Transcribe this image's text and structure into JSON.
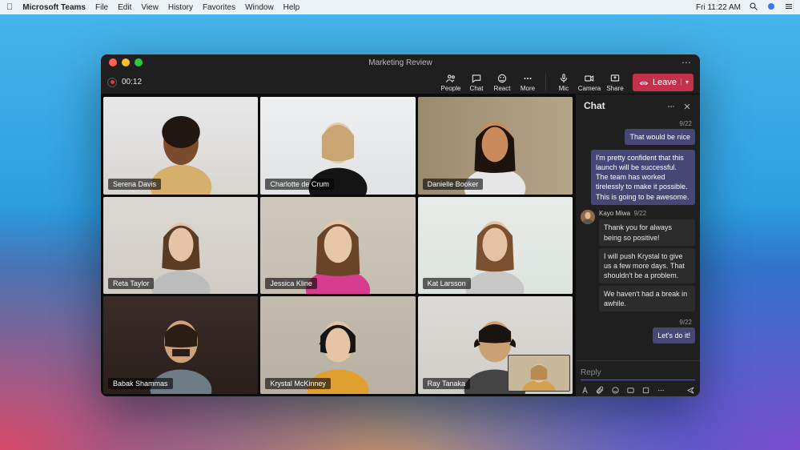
{
  "menubar": {
    "app_name": "Microsoft Teams",
    "items": [
      "File",
      "Edit",
      "View",
      "History",
      "Favorites",
      "Window",
      "Help"
    ],
    "clock": "Fri 11:22 AM"
  },
  "window": {
    "title": "Marketing Review"
  },
  "toolbar": {
    "rec_time": "00:12",
    "people_label": "People",
    "chat_label": "Chat",
    "react_label": "React",
    "more_label": "More",
    "mic_label": "Mic",
    "camera_label": "Camera",
    "share_label": "Share",
    "leave_label": "Leave"
  },
  "participants": [
    {
      "name": "Serena Davis",
      "skin": "#7a4b2d",
      "hair": "#221710",
      "top": "#d4b06a"
    },
    {
      "name": "Charlotte de Crum",
      "skin": "#e8c9ae",
      "hair": "#c9a574",
      "top": "#141414"
    },
    {
      "name": "Danielle Booker",
      "skin": "#c98b5c",
      "hair": "#1d130e",
      "top": "#e6e6e6"
    },
    {
      "name": "Reta Taylor",
      "skin": "#e6c3a6",
      "hair": "#5a3b24",
      "top": "#bcbcbc"
    },
    {
      "name": "Jessica Kline",
      "skin": "#e8c6a8",
      "hair": "#6a4427",
      "top": "#d63d8f"
    },
    {
      "name": "Kat Larsson",
      "skin": "#e4c2a4",
      "hair": "#7a5030",
      "top": "#c7c7c7"
    },
    {
      "name": "Babak Shammas",
      "skin": "#cfa27a",
      "hair": "#2a1d13",
      "top": "#6e7c85"
    },
    {
      "name": "Krystal McKinney",
      "skin": "#e6c4a6",
      "hair": "#141414",
      "top": "#e0a030"
    },
    {
      "name": "Ray Tanaka",
      "skin": "#caa174",
      "hair": "#1a1410",
      "top": "#444444"
    }
  ],
  "chat": {
    "title": "Chat",
    "messages": [
      {
        "type": "out",
        "time": "9/22",
        "text": "That would be nice"
      },
      {
        "type": "out",
        "text": "I'm pretty confident that this launch will be successful. The team has worked tirelessly to make it possible. This is going to be awesome."
      },
      {
        "type": "in",
        "author": "Kayo Miwa",
        "time": "9/22",
        "texts": [
          "Thank you for always being so positive!",
          "I will push Krystal to give us a few more days. That shouldn't be a problem.",
          "We haven't had a break in awhile."
        ]
      },
      {
        "type": "out",
        "time": "9/22",
        "text": "Let's do it!"
      }
    ],
    "reply_placeholder": "Reply"
  }
}
